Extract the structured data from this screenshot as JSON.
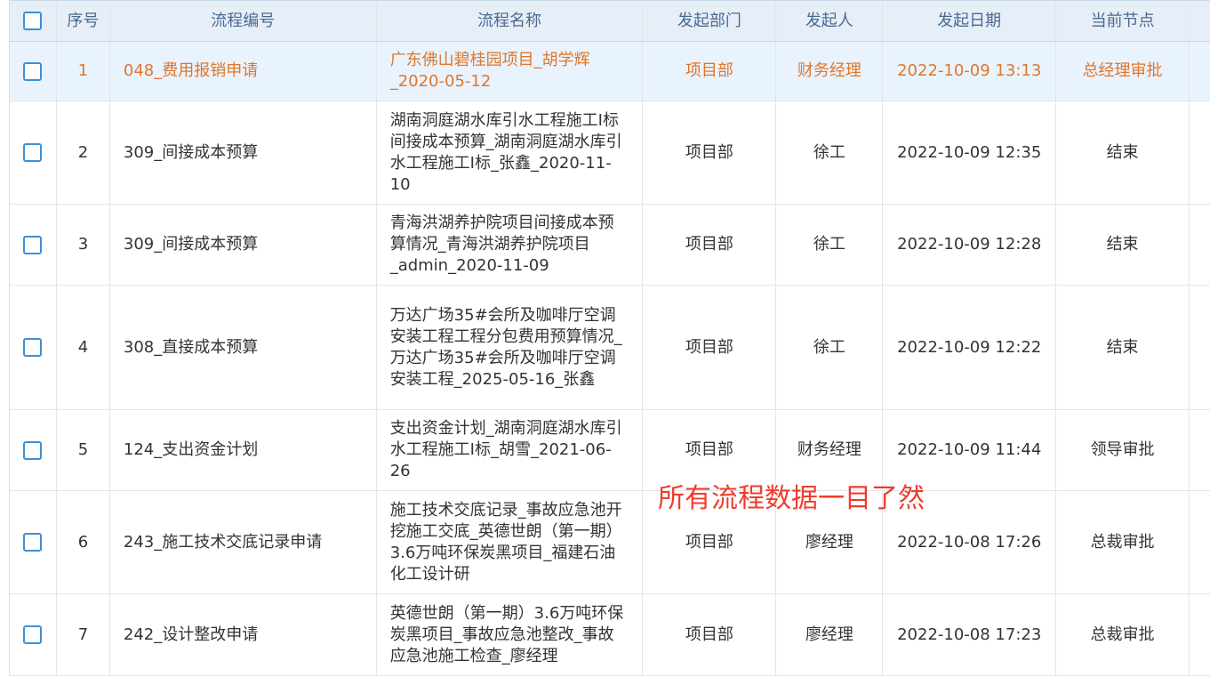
{
  "header": {
    "seq": "序号",
    "code": "流程编号",
    "name": "流程名称",
    "dept": "发起部门",
    "initiator": "发起人",
    "date": "发起日期",
    "node": "当前节点"
  },
  "rows": [
    {
      "seq": "1",
      "code": "048_费用报销申请",
      "name": "广东佛山碧桂园项目_胡学辉_2020-05-12",
      "dept": "项目部",
      "initiator": "财务经理",
      "date": "2022-10-09 13:13",
      "node": "总经理审批",
      "selected": true
    },
    {
      "seq": "2",
      "code": "309_间接成本预算",
      "name": "湖南洞庭湖水库引水工程施工I标间接成本预算_湖南洞庭湖水库引水工程施工I标_张鑫_2020-11-10",
      "dept": "项目部",
      "initiator": "徐工",
      "date": "2022-10-09 12:35",
      "node": "结束"
    },
    {
      "seq": "3",
      "code": "309_间接成本预算",
      "name": "青海洪湖养护院项目间接成本预算情况_青海洪湖养护院项目_admin_2020-11-09",
      "dept": "项目部",
      "initiator": "徐工",
      "date": "2022-10-09 12:28",
      "node": "结束"
    },
    {
      "seq": "4",
      "code": "308_直接成本预算",
      "name": "万达广场35#会所及咖啡厅空调安装工程工程分包费用预算情况_万达广场35#会所及咖啡厅空调安装工程_2025-05-16_张鑫",
      "dept": "项目部",
      "initiator": "徐工",
      "date": "2022-10-09 12:22",
      "node": "结束"
    },
    {
      "seq": "5",
      "code": "124_支出资金计划",
      "name": "支出资金计划_湖南洞庭湖水库引水工程施工I标_胡雪_2021-06-26",
      "dept": "项目部",
      "initiator": "财务经理",
      "date": "2022-10-09 11:44",
      "node": "领导审批"
    },
    {
      "seq": "6",
      "code": "243_施工技术交底记录申请",
      "name": "施工技术交底记录_事故应急池开挖施工交底_英德世朗（第一期）3.6万吨环保炭黑项目_福建石油化工设计研",
      "dept": "项目部",
      "initiator": "廖经理",
      "date": "2022-10-08 17:26",
      "node": "总裁审批"
    },
    {
      "seq": "7",
      "code": "242_设计整改申请",
      "name": "英德世朗（第一期）3.6万吨环保炭黑项目_事故应急池整改_事故应急池施工检查_廖经理",
      "dept": "项目部",
      "initiator": "廖经理",
      "date": "2022-10-08 17:23",
      "node": "总裁审批"
    }
  ],
  "overlay_text": "所有流程数据一目了然",
  "colors": {
    "header_bg": "#e6eef8",
    "header_text": "#4a6a90",
    "selected_row_bg": "#e9f3fd",
    "selected_row_text": "#e0762b",
    "checkbox_border": "#3f8fd6",
    "overlay_text": "#f03c2c"
  }
}
